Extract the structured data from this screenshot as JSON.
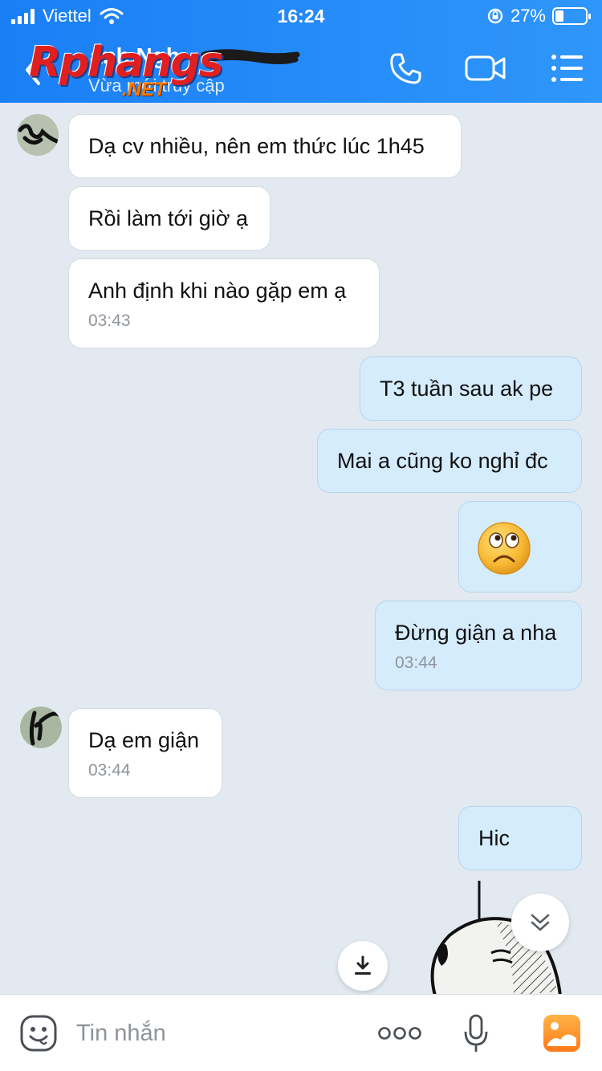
{
  "status_bar": {
    "carrier": "Viettel",
    "time": "16:24",
    "battery": "27%",
    "battery_level": 0.27
  },
  "header": {
    "name": "anh Ngh",
    "status": "Vừa mới truy cập",
    "watermark_main": "Rphangs",
    "watermark_sub": ".NET"
  },
  "messages": [
    {
      "side": "incoming",
      "text": "Dạ cv nhiều, nên em thức lúc 1h45",
      "time": ""
    },
    {
      "side": "incoming",
      "text": "Rồi làm tới giờ ạ",
      "time": ""
    },
    {
      "side": "incoming",
      "text": "Anh định khi nào gặp em ạ",
      "time": "03:43"
    },
    {
      "side": "outgoing",
      "text": "T3 tuần sau ak pe",
      "time": ""
    },
    {
      "side": "outgoing",
      "text": "Mai a cũng ko nghỉ đc",
      "time": ""
    },
    {
      "side": "outgoing",
      "text": "",
      "emoji": "sad-face",
      "time": ""
    },
    {
      "side": "outgoing",
      "text": "Đừng giận a nha",
      "time": "03:44"
    },
    {
      "side": "incoming",
      "text": "Dạ em giận",
      "time": "03:44"
    },
    {
      "side": "outgoing",
      "text": "Hic",
      "time": ""
    }
  ],
  "composer": {
    "placeholder": "Tin nhắn"
  },
  "colors": {
    "header": "#2f96fb",
    "background": "#e2e9f1",
    "outgoing_bubble": "#d5ecfd",
    "incoming_bubble": "#ffffff"
  },
  "icons": [
    "back-icon",
    "call-icon",
    "video-call-icon",
    "menu-icon",
    "scroll-down-icon",
    "download-icon",
    "emoji-icon",
    "more-icon",
    "mic-icon",
    "image-icon"
  ]
}
